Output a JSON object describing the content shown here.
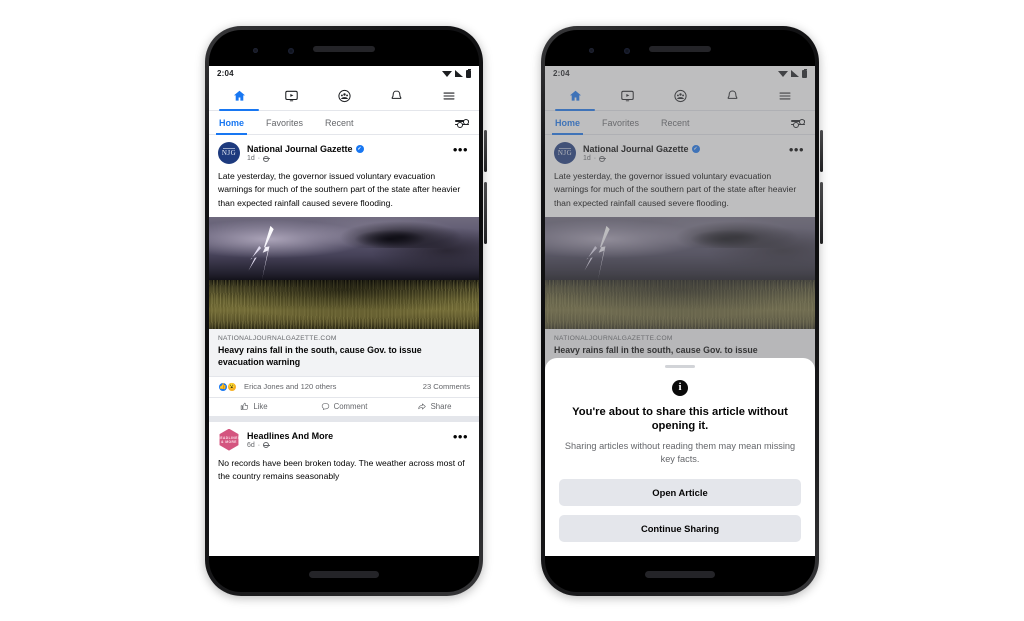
{
  "phones": {
    "left": {
      "label": "Facebook news feed without dialog"
    },
    "right": {
      "label": "Facebook news feed with share warning dialog"
    }
  },
  "status_bar": {
    "time": "2:04",
    "icons": [
      "wifi-icon",
      "cellular-signal-icon",
      "battery-icon"
    ]
  },
  "top_nav": [
    {
      "name": "home",
      "icon": "home-icon",
      "active": true
    },
    {
      "name": "watch",
      "icon": "video-screen-icon",
      "active": false
    },
    {
      "name": "groups",
      "icon": "groups-icon",
      "active": false
    },
    {
      "name": "notifications",
      "icon": "bell-icon",
      "active": false
    },
    {
      "name": "menu",
      "icon": "hamburger-menu-icon",
      "active": false
    }
  ],
  "feed_tabs": {
    "items": [
      {
        "label": "Home",
        "active": true
      },
      {
        "label": "Favorites",
        "active": false
      },
      {
        "label": "Recent",
        "active": false
      }
    ],
    "filter_icon": "sliders-filter-icon"
  },
  "post": {
    "avatar_text": "NJG",
    "author": "National Journal Gazette",
    "verified_icon": "verified-badge-icon",
    "time": "1d",
    "audience_icon": "globe-icon",
    "more_icon": "more-options-icon",
    "body": "Late yesterday, the governor issued voluntary evacuation warnings for much of the southern part of the state after heavier than expected rainfall caused severe flooding.",
    "image_alt": "storm-photo-lightning-over-field",
    "link_domain": "NATIONALJOURNALGAZETTE.COM",
    "link_title": "Heavy rains fall in the south, cause Gov. to issue evacuation warning",
    "reactions_text": "Erica Jones and 120 others",
    "reaction_icons": [
      "like-reaction-icon",
      "wow-reaction-icon"
    ],
    "comments_text": "23 Comments",
    "actions": [
      {
        "label": "Like",
        "icon": "thumbs-up-icon"
      },
      {
        "label": "Comment",
        "icon": "comment-bubble-icon"
      },
      {
        "label": "Share",
        "icon": "share-arrow-icon"
      }
    ]
  },
  "post2": {
    "avatar_text": "HEADLINES & MORE",
    "author": "Headlines And More",
    "time": "6d",
    "audience_icon": "globe-icon",
    "more_icon": "more-options-icon",
    "body": "No records have been broken today. The weather across most of the country remains seasonably"
  },
  "dialog": {
    "handle": "drag-handle",
    "icon": "info-icon",
    "icon_glyph": "i",
    "title": "You're about to share this article without opening it.",
    "subtitle": "Sharing articles without reading them may mean missing key facts.",
    "primary_button": "Open Article",
    "secondary_button": "Continue Sharing"
  },
  "colors": {
    "brand_blue": "#1877f2",
    "button_gray": "#e4e6eb",
    "text_primary": "#050505",
    "text_secondary": "#65676b",
    "avatar_navy": "#1d3a7e",
    "avatar_pink": "#d4557f"
  }
}
